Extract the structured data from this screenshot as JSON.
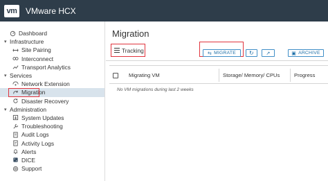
{
  "header": {
    "logo_text": "vm",
    "title": "VMware HCX"
  },
  "sidebar": {
    "dashboard": "Dashboard",
    "sections": [
      {
        "label": "Infrastructure",
        "items": [
          "Site Pairing",
          "Interconnect",
          "Transport Analytics"
        ]
      },
      {
        "label": "Services",
        "items": [
          "Network Extension",
          "Migration",
          "Disaster Recovery"
        ]
      },
      {
        "label": "Administration",
        "items": [
          "System Updates",
          "Troubleshooting",
          "Audit Logs",
          "Activity Logs",
          "Alerts",
          "DICE",
          "Support"
        ]
      }
    ],
    "active_item": "Migration"
  },
  "main": {
    "title": "Migration",
    "tab_label": "Tracking",
    "buttons": {
      "migrate": "MIGRATE",
      "archive": "ARCHIVE"
    },
    "table": {
      "columns": [
        "Migrating VM",
        "Storage/ Memory/ CPUs",
        "Progress"
      ],
      "empty_message": "No VM migrations during last 2 weeks"
    }
  },
  "colors": {
    "topbar": "#2e3d4a",
    "accent": "#1d6fa8",
    "highlight": "#e0333c",
    "active_bg": "#d8e3ec"
  }
}
